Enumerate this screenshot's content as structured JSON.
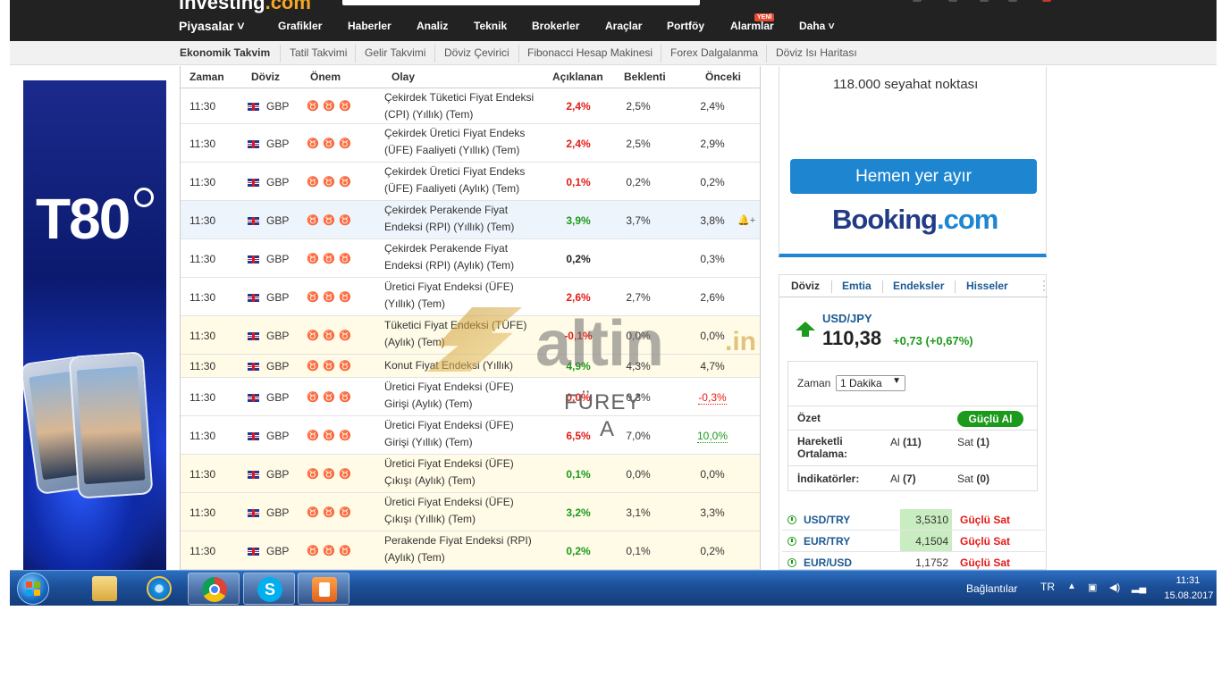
{
  "site": {
    "logo_main": "investing",
    "logo_suffix": ".com"
  },
  "nav": {
    "items": [
      {
        "label": "Piyasalar ˅"
      },
      {
        "label": "Grafikler"
      },
      {
        "label": "Haberler"
      },
      {
        "label": "Analiz"
      },
      {
        "label": "Teknik"
      },
      {
        "label": "Brokerler"
      },
      {
        "label": "Araçlar"
      },
      {
        "label": "Portföy"
      },
      {
        "label": "Alarmlar"
      },
      {
        "label": "Daha ˅"
      }
    ],
    "new_badge": "YENİ"
  },
  "subnav": {
    "items": [
      {
        "label": "Ekonomik Takvim"
      },
      {
        "label": "Tatil Takvimi"
      },
      {
        "label": "Gelir Takvimi"
      },
      {
        "label": "Döviz Çevirici"
      },
      {
        "label": "Fibonacci Hesap Makinesi"
      },
      {
        "label": "Forex Dalgalanma"
      },
      {
        "label": "Döviz Isı Haritası"
      }
    ]
  },
  "ad": {
    "text": "T80"
  },
  "calendar": {
    "headers": {
      "time": "Zaman",
      "currency": "Döviz",
      "importance": "Önem",
      "event": "Olay",
      "actual": "Açıklanan",
      "forecast": "Beklenti",
      "previous": "Önceki"
    },
    "rows": [
      {
        "time": "11:30",
        "currency": "GBP",
        "importance": 1,
        "event": "Çekirdek Tüketici Fiyat Endeksi (CPI) (Yıllık) (Tem)",
        "actual": "2,4%",
        "actual_color": "red",
        "forecast": "2,5%",
        "previous": "2,4%",
        "bg": "white"
      },
      {
        "time": "11:30",
        "currency": "GBP",
        "importance": 1,
        "event": "Çekirdek Üretici Fiyat Endeks (ÜFE) Faaliyeti (Yıllık) (Tem)",
        "actual": "2,4%",
        "actual_color": "red",
        "forecast": "2,5%",
        "previous": "2,9%",
        "bg": "white"
      },
      {
        "time": "11:30",
        "currency": "GBP",
        "importance": 1,
        "event": "Çekirdek Üretici Fiyat Endeks (ÜFE) Faaliyeti (Aylık) (Tem)",
        "actual": "0,1%",
        "actual_color": "red",
        "forecast": "0,2%",
        "previous": "0,2%",
        "bg": "white"
      },
      {
        "time": "11:30",
        "currency": "GBP",
        "importance": 1,
        "event": "Çekirdek Perakende Fiyat Endeksi (RPI) (Yıllık) (Tem)",
        "actual": "3,9%",
        "actual_color": "green",
        "forecast": "3,7%",
        "previous": "3,8%",
        "bg": "blue",
        "bell": "🔔+"
      },
      {
        "time": "11:30",
        "currency": "GBP",
        "importance": 1,
        "event": "Çekirdek Perakende Fiyat Endeksi (RPI) (Aylık) (Tem)",
        "actual": "0,2%",
        "actual_color": "black",
        "forecast": "",
        "previous": "0,3%",
        "bg": "white"
      },
      {
        "time": "11:30",
        "currency": "GBP",
        "importance": 3,
        "event": "Üretici Fiyat Endeksi (ÜFE) (Yıllık) (Tem)",
        "actual": "2,6%",
        "actual_color": "red",
        "forecast": "2,7%",
        "previous": "2,6%",
        "bg": "white"
      },
      {
        "time": "11:30",
        "currency": "GBP",
        "importance": 2,
        "event": "Tüketici Fiyat Endeksi (TÜFE) (Aylık) (Tem)",
        "actual": "-0,1%",
        "actual_color": "red",
        "forecast": "0,0%",
        "previous": "0,0%",
        "bg": "yellow"
      },
      {
        "time": "11:30",
        "currency": "GBP",
        "importance": 1,
        "event": "Konut Fiyat Endeksi (Yıllık)",
        "actual": "4,9%",
        "actual_color": "green",
        "forecast": "4,3%",
        "previous": "4,7%",
        "bg": "yellow"
      },
      {
        "time": "11:30",
        "currency": "GBP",
        "importance": 2,
        "event": "Üretici Fiyat Endeksi (ÜFE) Girişi (Aylık) (Tem)",
        "actual": "0,0%",
        "actual_color": "red",
        "forecast": "0,3%",
        "previous": "-0,3%",
        "previous_style": "under-red",
        "bg": "white"
      },
      {
        "time": "11:30",
        "currency": "GBP",
        "importance": 1,
        "event": "Üretici Fiyat Endeksi (ÜFE) Girişi (Yıllık) (Tem)",
        "actual": "6,5%",
        "actual_color": "red",
        "forecast": "7,0%",
        "previous": "10,0%",
        "previous_style": "under-green",
        "bg": "white"
      },
      {
        "time": "11:30",
        "currency": "GBP",
        "importance": 1,
        "event": "Üretici Fiyat Endeksi (ÜFE) Çıkışı (Aylık) (Tem)",
        "actual": "0,1%",
        "actual_color": "green",
        "forecast": "0,0%",
        "previous": "0,0%",
        "bg": "yellow"
      },
      {
        "time": "11:30",
        "currency": "GBP",
        "importance": 1,
        "event": "Üretici Fiyat Endeksi (ÜFE) Çıkışı (Yıllık) (Tem)",
        "actual": "3,2%",
        "actual_color": "green",
        "forecast": "3,1%",
        "previous": "3,3%",
        "bg": "yellow"
      },
      {
        "time": "11:30",
        "currency": "GBP",
        "importance": 1,
        "event": "Perakende Fiyat Endeksi (RPI) (Aylık) (Tem)",
        "actual": "0,2%",
        "actual_color": "green",
        "forecast": "0,1%",
        "previous": "0,2%",
        "bg": "yellow"
      }
    ]
  },
  "watermark": {
    "brand": "altin",
    "suffix": ".in",
    "name_line1": "FÜREY",
    "name_line2": "A"
  },
  "booking": {
    "points": "118.000 seyahat noktası",
    "button": "Hemen yer ayır",
    "logo_main": "Booking",
    "logo_suffix": ".com"
  },
  "widget": {
    "tabs": [
      {
        "label": "Döviz"
      },
      {
        "label": "Emtia"
      },
      {
        "label": "Endeksler"
      },
      {
        "label": "Hisseler"
      }
    ],
    "pair": "USD/JPY",
    "price": "110,38",
    "change": "+0,73 (+0,67%)",
    "timeframe_label": "Zaman",
    "timeframe_value": "1 Dakika",
    "summary_label": "Özet",
    "summary_value": "Güçlü Al",
    "ma_label_1": "Hareketli",
    "ma_label_2": "Ortalama:",
    "ma_buy": "Al",
    "ma_buy_count": "(11)",
    "ma_sell": "Sat",
    "ma_sell_count": "(1)",
    "ind_label": "İndikatörler:",
    "ind_buy": "Al",
    "ind_buy_count": "(7)",
    "ind_sell": "Sat",
    "ind_sell_count": "(0)",
    "quotes": [
      {
        "pair": "USD/TRY",
        "price": "3,5310",
        "signal": "Güçlü Sat",
        "highlight": true
      },
      {
        "pair": "EUR/TRY",
        "price": "4,1504",
        "signal": "Güçlü Sat",
        "highlight": true
      },
      {
        "pair": "EUR/USD",
        "price": "1,1752",
        "signal": "Güçlü Sat",
        "highlight": false
      }
    ]
  },
  "taskbar": {
    "tray_label": "Bağlantılar",
    "lang": "TR",
    "time": "11:31",
    "date": "15.08.2017"
  },
  "colors": {
    "nav_bg": "#222222",
    "positive": "#1b9a1b",
    "negative": "#e41b17",
    "link": "#1c5a93",
    "booking_blue": "#1e86d1"
  }
}
